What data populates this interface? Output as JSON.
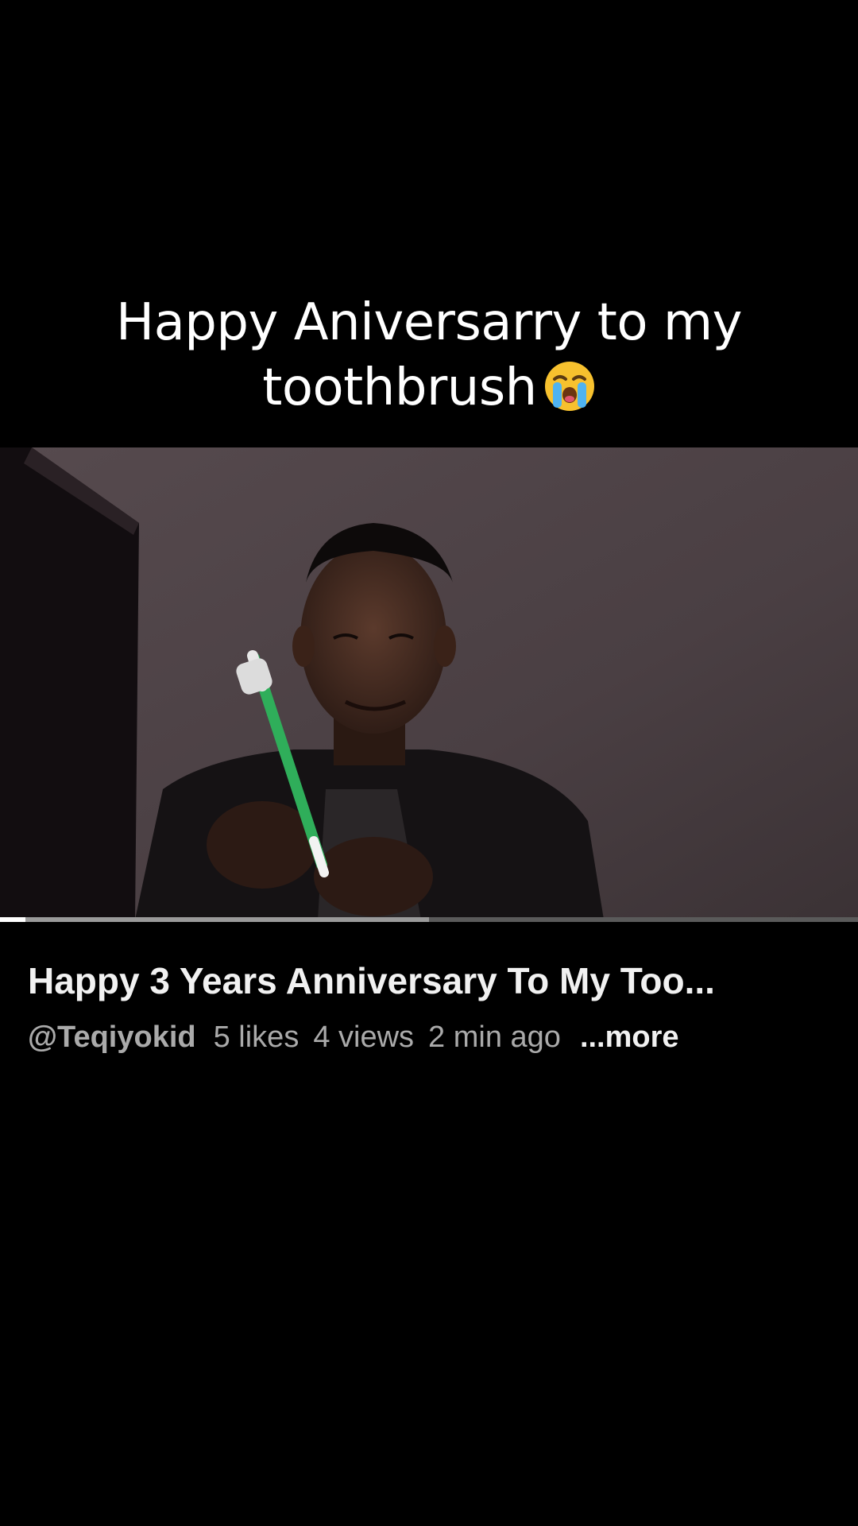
{
  "caption": {
    "line1": "Happy Aniversarry to my",
    "line2": "toothbrush",
    "emoji": "loudly-crying-face-emoji"
  },
  "video": {
    "description": "",
    "progress_played": 0.03,
    "progress_buffered": 0.5
  },
  "details": {
    "title": "Happy 3 Years Anniversary To My Too...",
    "channel": "@Teqiyokid",
    "likes": "5 likes",
    "views": "4 views",
    "time_ago": "2 min ago",
    "more_label": "...more"
  },
  "colors": {
    "background": "#000000",
    "wall": "#4a3f43",
    "progress_played": "#ffffff",
    "progress_track": "#5a5a5a",
    "toothbrush_handle": "#2fae5a"
  }
}
